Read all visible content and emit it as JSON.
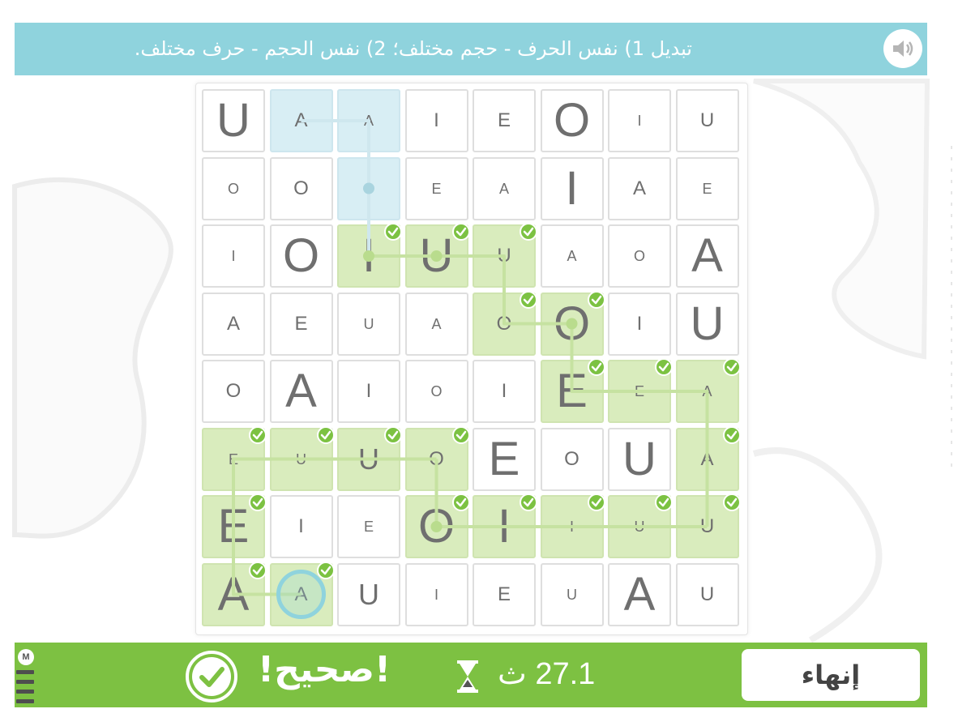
{
  "header": {
    "instruction_line1": "تبديل 1) نفس الحرف - حجم مختلف؛ 2) نفس الحجم - حرف مختلف.",
    "sound_icon": "speaker-icon"
  },
  "board": {
    "rows": [
      [
        {
          "l": "U",
          "s": "l"
        },
        {
          "l": "A",
          "s": "s",
          "state": "active"
        },
        {
          "l": "A",
          "s": "xs",
          "state": "active"
        },
        {
          "l": "I",
          "s": "s"
        },
        {
          "l": "E",
          "s": "s"
        },
        {
          "l": "O",
          "s": "l"
        },
        {
          "l": "I",
          "s": "xs"
        },
        {
          "l": "U",
          "s": "s"
        }
      ],
      [
        {
          "l": "O",
          "s": "xs"
        },
        {
          "l": "O",
          "s": "s"
        },
        {
          "l": "",
          "s": "xs",
          "state": "active"
        },
        {
          "l": "E",
          "s": "xs"
        },
        {
          "l": "A",
          "s": "xs"
        },
        {
          "l": "I",
          "s": "l"
        },
        {
          "l": "A",
          "s": "s"
        },
        {
          "l": "E",
          "s": "xs"
        }
      ],
      [
        {
          "l": "I",
          "s": "xs"
        },
        {
          "l": "O",
          "s": "l"
        },
        {
          "l": "I",
          "s": "l",
          "state": "found"
        },
        {
          "l": "U",
          "s": "l",
          "state": "found"
        },
        {
          "l": "U",
          "s": "s",
          "state": "found"
        },
        {
          "l": "A",
          "s": "xs"
        },
        {
          "l": "O",
          "s": "xs"
        },
        {
          "l": "A",
          "s": "l"
        }
      ],
      [
        {
          "l": "A",
          "s": "s"
        },
        {
          "l": "E",
          "s": "s"
        },
        {
          "l": "U",
          "s": "xs"
        },
        {
          "l": "A",
          "s": "xs"
        },
        {
          "l": "O",
          "s": "s",
          "state": "found"
        },
        {
          "l": "O",
          "s": "l",
          "state": "found"
        },
        {
          "l": "I",
          "s": "s"
        },
        {
          "l": "U",
          "s": "l"
        }
      ],
      [
        {
          "l": "O",
          "s": "s"
        },
        {
          "l": "A",
          "s": "l"
        },
        {
          "l": "I",
          "s": "s"
        },
        {
          "l": "O",
          "s": "xs"
        },
        {
          "l": "I",
          "s": "s"
        },
        {
          "l": "E",
          "s": "l",
          "state": "found"
        },
        {
          "l": "E",
          "s": "xs",
          "state": "found"
        },
        {
          "l": "A",
          "s": "xs",
          "state": "found"
        }
      ],
      [
        {
          "l": "E",
          "s": "xs",
          "state": "found"
        },
        {
          "l": "U",
          "s": "xs",
          "state": "found"
        },
        {
          "l": "U",
          "s": "m",
          "state": "found"
        },
        {
          "l": "O",
          "s": "s",
          "state": "found"
        },
        {
          "l": "E",
          "s": "l"
        },
        {
          "l": "O",
          "s": "s"
        },
        {
          "l": "U",
          "s": "l"
        },
        {
          "l": "A",
          "s": "s",
          "state": "found"
        }
      ],
      [
        {
          "l": "E",
          "s": "l",
          "state": "found"
        },
        {
          "l": "I",
          "s": "s"
        },
        {
          "l": "E",
          "s": "xs"
        },
        {
          "l": "O",
          "s": "l",
          "state": "found"
        },
        {
          "l": "I",
          "s": "l",
          "state": "found"
        },
        {
          "l": "I",
          "s": "xs",
          "state": "found"
        },
        {
          "l": "U",
          "s": "xs",
          "state": "found"
        },
        {
          "l": "U",
          "s": "s",
          "state": "found"
        }
      ],
      [
        {
          "l": "A",
          "s": "l",
          "state": "found"
        },
        {
          "l": "A",
          "s": "s",
          "state": "found"
        },
        {
          "l": "U",
          "s": "m"
        },
        {
          "l": "I",
          "s": "xs"
        },
        {
          "l": "E",
          "s": "s"
        },
        {
          "l": "U",
          "s": "xs"
        },
        {
          "l": "A",
          "s": "l"
        },
        {
          "l": "U",
          "s": "s"
        }
      ]
    ]
  },
  "footer": {
    "menu_label": "M",
    "status_text": "!صحيح!",
    "status_icon": "check-circle-icon",
    "timer_value": "27.1 ث",
    "timer_icon": "hourglass-icon",
    "finish_label": "إنهاء"
  },
  "colors": {
    "header_bg": "#8fd3dd",
    "footer_bg": "#7dc142",
    "found_cell": "#d9ecbd",
    "active_cell": "#d8eef4"
  }
}
